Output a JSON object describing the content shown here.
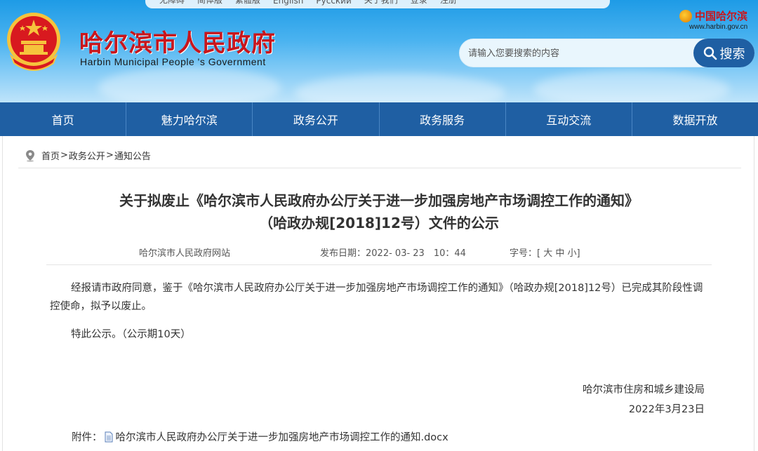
{
  "header": {
    "topbar": [
      "无障碍",
      "简体版",
      "繁體版",
      "English",
      "Русский",
      "关于我们",
      "登录",
      "注册"
    ],
    "site_title": "哈尔滨市人民政府",
    "site_subtitle": "Harbin Municipal People 's Government",
    "brand_logo": "中国哈尔滨",
    "brand_url": "www.harbin.gov.cn",
    "search_placeholder": "请输入您要搜索的内容",
    "search_button": "搜索"
  },
  "nav": [
    "首页",
    "魅力哈尔滨",
    "政务公开",
    "政务服务",
    "互动交流",
    "数据开放"
  ],
  "breadcrumb": [
    "首页",
    "政务公开",
    "通知公告"
  ],
  "breadcrumb_sep": ">",
  "document": {
    "title_line1": "关于拟废止《哈尔滨市人民政府办公厅关于进一步加强房地产市场调控工作的通知》",
    "title_line2": "（哈政办规[2018]12号）文件的公示",
    "source": "哈尔滨市人民政府网站",
    "date_label": "发布日期：",
    "date_value": "2022- 03- 23　10：44",
    "font_label": "字号：[",
    "font_large": "大",
    "font_medium": "中",
    "font_small": "小",
    "font_close": "]",
    "paragraph1": "经报请市政府同意，鉴于《哈尔滨市人民政府办公厅关于进一步加强房地产市场调控工作的通知》（哈政办规[2018]12号）已完成其阶段性调控使命，拟予以废止。",
    "paragraph2": "特此公示。（公示期10天）",
    "signature_org": "哈尔滨市住房和城乡建设局",
    "signature_date": "2022年3月23日",
    "attachment_label": "附件：",
    "attachment_name": "哈尔滨市人民政府办公厅关于进一步加强房地产市场调控工作的通知.docx"
  },
  "colors": {
    "header_blue": "#1e9be6",
    "nav_blue": "#1f5fa3",
    "title_red": "#c8161d"
  }
}
